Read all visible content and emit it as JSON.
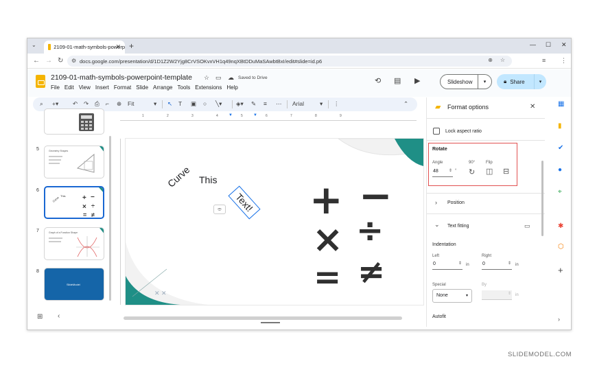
{
  "browser": {
    "tab_title": "2109-01-math-symbols-powerp",
    "url": "docs.google.com/presentation/d/1D1Z2W2Yjg8CrVSOKvxVH1q49nqXBtDDuMaSAwbtBxI/edit#slide=id.p6"
  },
  "doc": {
    "title": "2109-01-math-symbols-powerpoint-template",
    "saved_status": "Saved to Drive",
    "menu": [
      "File",
      "Edit",
      "View",
      "Insert",
      "Format",
      "Slide",
      "Arrange",
      "Tools",
      "Extensions",
      "Help"
    ],
    "slideshow_label": "Slideshow",
    "share_label": "Share"
  },
  "toolbar": {
    "zoom": "Fit",
    "font": "Arial"
  },
  "filmstrip": {
    "slides": [
      {
        "num": "5",
        "title": "Geometry Shapes"
      },
      {
        "num": "6",
        "title": ""
      },
      {
        "num": "7",
        "title": "Graph of a Function Shape"
      },
      {
        "num": "8",
        "title": "SlideModel"
      }
    ]
  },
  "canvas": {
    "word_curve": "Curve",
    "word_this": "This",
    "word_text": "Text!",
    "symbols": {
      "plus": "+",
      "minus": "−",
      "times": "×",
      "divide": "÷",
      "equals": "=",
      "notequal": "≠"
    }
  },
  "format_panel": {
    "title": "Format options",
    "lock_aspect": "Lock aspect ratio",
    "rotate_section": "Rotate",
    "angle_label": "Angle",
    "angle_value": "48",
    "angle_unit": "°",
    "ninety_label": "90°",
    "flip_label": "Flip",
    "position_section": "Position",
    "text_fitting_section": "Text fitting",
    "indentation_label": "Indentation",
    "left_label": "Left",
    "left_value": "0",
    "left_unit": "in",
    "right_label": "Right",
    "right_value": "0",
    "right_unit": "in",
    "special_label": "Special",
    "special_value": "None",
    "by_label": "By",
    "by_unit": "in",
    "autofit_label": "Autofit"
  },
  "watermark": "SLIDEMODEL.COM",
  "colors": {
    "accent_blue": "#1967d2",
    "teal": "#1f8f86",
    "highlight_red": "#e15050",
    "share_bg": "#c2e7ff"
  }
}
